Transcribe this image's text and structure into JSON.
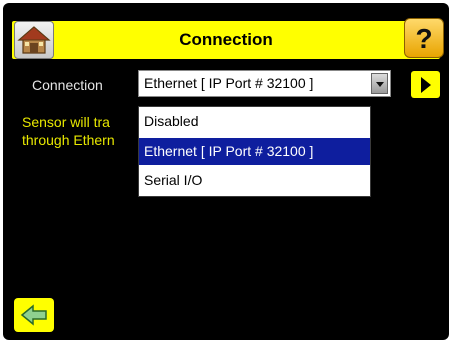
{
  "header": {
    "title": "Connection"
  },
  "connection_row": {
    "label": "Connection",
    "selected_value": "Ethernet [ IP Port # 32100 ]"
  },
  "message_lines": [
    "Sensor will tra",
    "through Ethern"
  ],
  "dropdown": {
    "options": [
      "Disabled",
      "Ethernet [ IP Port # 32100 ]",
      "Serial I/O"
    ],
    "selected_index": 1
  },
  "help_button": {
    "label": "?"
  },
  "colors": {
    "accent": "#ffff00",
    "background": "#000000",
    "selection": "#0e1e9e",
    "message_text": "#e8e800"
  },
  "icons": [
    "home-icon",
    "help-icon",
    "next-arrow-icon",
    "back-arrow-icon",
    "dropdown-arrow-icon"
  ]
}
